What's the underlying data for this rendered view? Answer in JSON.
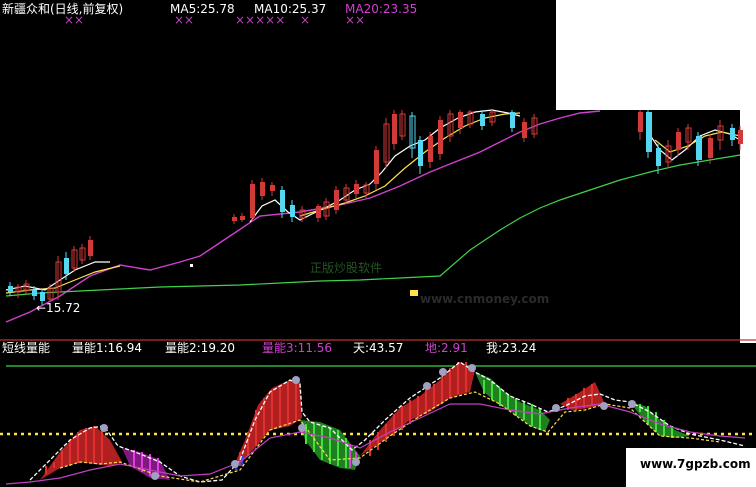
{
  "top_panel": {
    "title": "新疆众和(日线,前复权)",
    "ma5": "MA5:25.78",
    "ma10": "MA10:25.37",
    "ma20": "MA20:23.35",
    "marks1": "××",
    "marks2": "××",
    "marks3": "×××××",
    "marks4": "×",
    "marks5": "××",
    "low_price_label": "←15.72",
    "watermark_top": "正版炒股软件",
    "watermark_url": "www.cnmoney.com"
  },
  "bottom_panel": {
    "indicator_name": "短线量能",
    "v1": "量能1:16.94",
    "v2": "量能2:19.20",
    "v3": "量能3:11.56",
    "v4": "天:43.57",
    "v5": "地:2.91",
    "v6": "我:23.24"
  },
  "footer": {
    "site_watermark": "www.7gpzb.com"
  },
  "colors": {
    "background": "#000000",
    "up_candle": "#d23a3a",
    "down_candle": "#54d7f0",
    "ma5": "#ffffff",
    "ma10": "#ffe24a",
    "ma20": "#e050e0",
    "long_ma": "#3fd24a",
    "indicator_red": "#e02020",
    "indicator_green": "#40e040",
    "dotted_line": "#ffe24a"
  }
}
